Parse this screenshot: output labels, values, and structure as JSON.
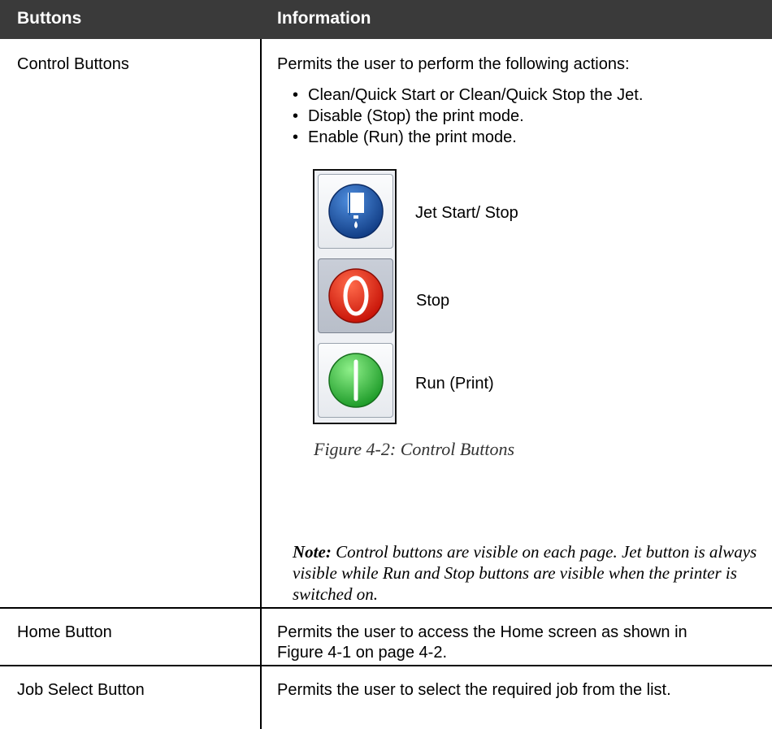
{
  "table": {
    "headers": [
      "Buttons",
      "Information"
    ],
    "rows": [
      {
        "button": "Control Buttons",
        "intro": "Permits the user to perform the following actions:",
        "bullets": [
          "Clean/Quick Start or Clean/Quick Stop the Jet.",
          "Disable (Stop) the print mode.",
          "Enable (Run) the print mode."
        ],
        "icons": [
          {
            "icon": "jet-icon",
            "label": "Jet Start/ Stop",
            "color": "#1f5fb0"
          },
          {
            "icon": "stop-icon",
            "label": "Stop",
            "color": "#e02a1a"
          },
          {
            "icon": "run-icon",
            "label": "Run (Print)",
            "color": "#2fc23a"
          }
        ],
        "caption": "Figure 4-2: Control Buttons",
        "note_label": "Note:",
        "note_text": " Control buttons are visible on each page. Jet button is always visible while Run and Stop buttons are visible when the printer is switched on."
      },
      {
        "button": "Home Button",
        "info": "Permits the user to access the Home screen as shown in Figure 4-1 on page 4-2."
      },
      {
        "button": "Job Select Button",
        "info": "Permits the user to select the required job from the list."
      }
    ]
  }
}
